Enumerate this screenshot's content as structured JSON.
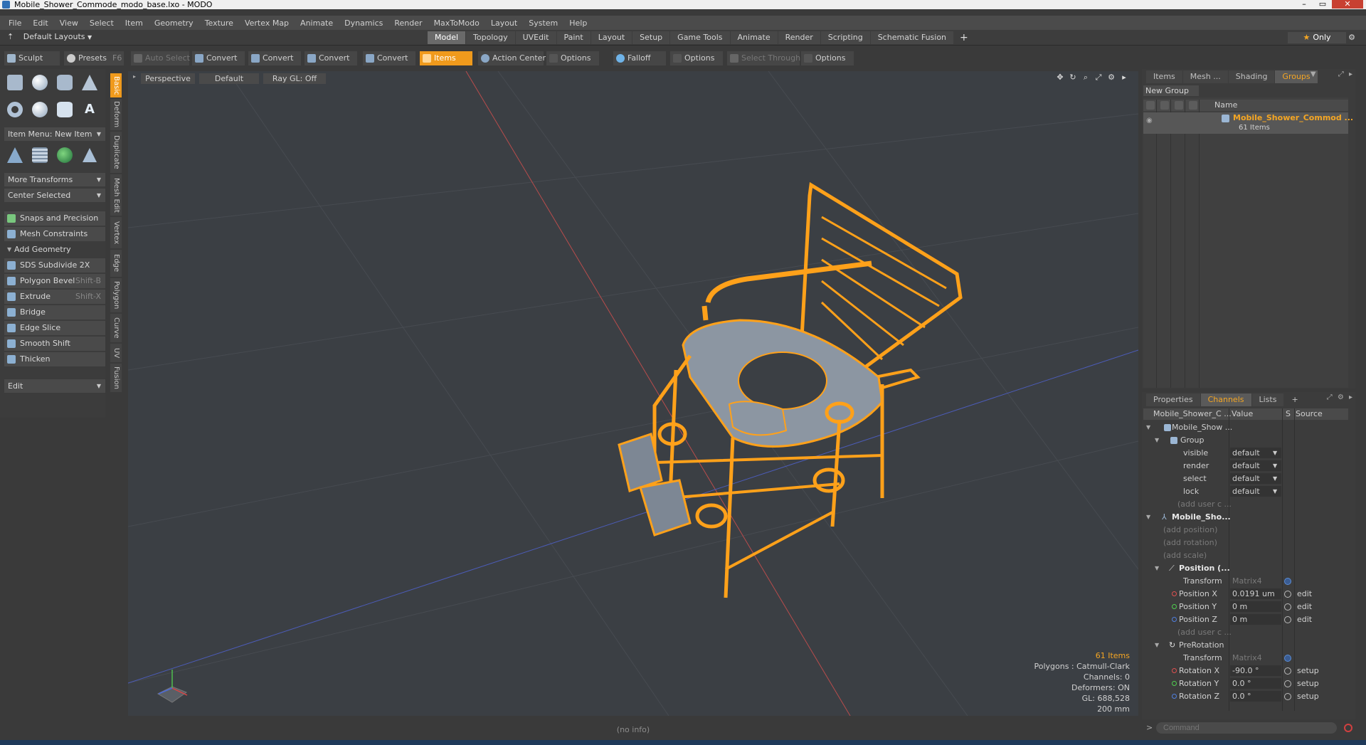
{
  "window": {
    "title": "Mobile_Shower_Commode_modo_base.lxo - MODO"
  },
  "menu": [
    "File",
    "Edit",
    "View",
    "Select",
    "Item",
    "Geometry",
    "Texture",
    "Vertex Map",
    "Animate",
    "Dynamics",
    "Render",
    "MaxToModo",
    "Layout",
    "System",
    "Help"
  ],
  "layouts": {
    "label": "Default Layouts"
  },
  "tabs": [
    "Model",
    "Topology",
    "UVEdit",
    "Paint",
    "Layout",
    "Setup",
    "Game Tools",
    "Animate",
    "Render",
    "Scripting",
    "Schematic Fusion"
  ],
  "tabs_plus": "+",
  "only": "Only",
  "toolbar": {
    "sculpt": "Sculpt",
    "presets": "Presets",
    "presets_key": "F6",
    "auto_select": "Auto Select",
    "convert1": "Convert",
    "convert2": "Convert",
    "convert3": "Convert",
    "convert4": "Convert",
    "items": "Items",
    "action_center": "Action Center",
    "options1": "Options",
    "falloff": "Falloff",
    "options2": "Options",
    "select_through": "Select Through",
    "options3": "Options"
  },
  "left": {
    "item_menu": "Item Menu: New Item",
    "more_transforms": "More Transforms",
    "center_selected": "Center Selected",
    "snaps": "Snaps and Precision",
    "mesh_constraints": "Mesh Constraints",
    "add_geometry": "Add Geometry",
    "tools": [
      {
        "label": "SDS Subdivide 2X",
        "key": ""
      },
      {
        "label": "Polygon Bevel",
        "key": "Shift-B"
      },
      {
        "label": "Extrude",
        "key": "Shift-X"
      },
      {
        "label": "Bridge",
        "key": ""
      },
      {
        "label": "Edge Slice",
        "key": ""
      },
      {
        "label": "Smooth Shift",
        "key": ""
      },
      {
        "label": "Thicken",
        "key": ""
      }
    ],
    "edit": "Edit"
  },
  "vtabs": [
    "Basic",
    "Deform",
    "Duplicate",
    "Mesh Edit",
    "Vertex",
    "Edge",
    "Polygon",
    "Curve",
    "UV",
    "Fusion"
  ],
  "viewport": {
    "view": "Perspective",
    "shading": "Default",
    "raygl": "Ray GL: Off",
    "info": {
      "items": "61 Items",
      "polygons": "Polygons : Catmull-Clark",
      "channels": "Channels: 0",
      "deformers": "Deformers: ON",
      "gl": "GL: 688,528",
      "scale": "200 mm"
    },
    "status": "(no info)"
  },
  "groups_panel": {
    "tabs": [
      "Items",
      "Mesh ...",
      "Shading",
      "Groups"
    ],
    "new_group": "New Group",
    "col_name": "Name",
    "row_name": "Mobile_Shower_Commod ...",
    "row_count": "61 Items"
  },
  "channels_panel": {
    "tabs": [
      "Properties",
      "Channels",
      "Lists"
    ],
    "tabs_plus": "+",
    "header": {
      "name": "Mobile_Shower_C ...",
      "value": "Value",
      "s": "S",
      "source": "Source"
    },
    "rows": [
      {
        "label": "Mobile_Show ...",
        "value": "",
        "source": ""
      },
      {
        "label": "Group",
        "value": "",
        "source": ""
      },
      {
        "label": "visible",
        "value": "default",
        "source": ""
      },
      {
        "label": "render",
        "value": "default",
        "source": ""
      },
      {
        "label": "select",
        "value": "default",
        "source": ""
      },
      {
        "label": "lock",
        "value": "default",
        "source": ""
      },
      {
        "label": "(add user c ...",
        "value": "",
        "source": ""
      },
      {
        "label": "Mobile_Sho...",
        "value": "",
        "source": ""
      },
      {
        "label": "(add position)",
        "value": "",
        "source": ""
      },
      {
        "label": "(add rotation)",
        "value": "",
        "source": ""
      },
      {
        "label": "(add scale)",
        "value": "",
        "source": ""
      },
      {
        "label": "Position (...",
        "value": "",
        "source": ""
      },
      {
        "label": "Transform",
        "value": "Matrix4",
        "source": ""
      },
      {
        "label": "Position X",
        "value": "0.0191 um",
        "source": "edit"
      },
      {
        "label": "Position Y",
        "value": "0 m",
        "source": "edit"
      },
      {
        "label": "Position Z",
        "value": "0 m",
        "source": "edit"
      },
      {
        "label": "(add user c ...",
        "value": "",
        "source": ""
      },
      {
        "label": "PreRotation",
        "value": "",
        "source": ""
      },
      {
        "label": "Transform",
        "value": "Matrix4",
        "source": ""
      },
      {
        "label": "Rotation X",
        "value": "-90.0 °",
        "source": "setup"
      },
      {
        "label": "Rotation Y",
        "value": "0.0 °",
        "source": "setup"
      },
      {
        "label": "Rotation Z",
        "value": "0.0 °",
        "source": "setup"
      }
    ]
  },
  "command": {
    "prompt": ">",
    "placeholder": "Command"
  },
  "colors": {
    "accent": "#f09a1c",
    "selection": "#f5a623",
    "wire": "#ffa11a"
  }
}
